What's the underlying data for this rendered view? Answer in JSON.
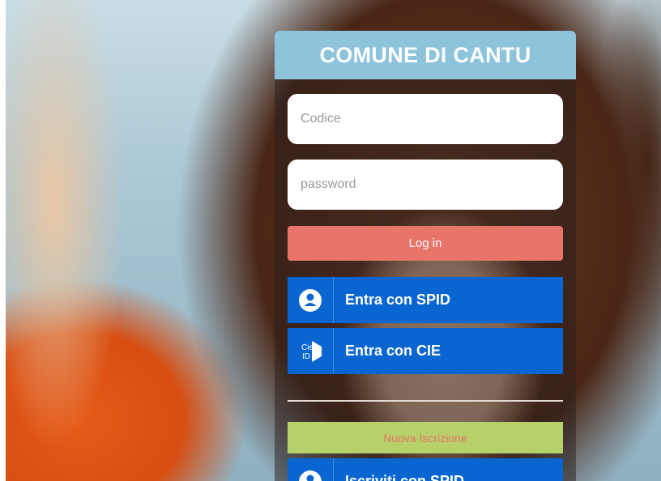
{
  "header": {
    "title": "COMUNE DI CANTU"
  },
  "form": {
    "code_placeholder": "Codice",
    "password_placeholder": "password",
    "login_label": "Log in"
  },
  "spid": {
    "label": "Entra con SPID",
    "icon": "spid-user-icon"
  },
  "cie": {
    "label": "Entra con CIE",
    "icon": "cie-id-icon",
    "icon_text_top": "Cie",
    "icon_text_bottom": "ID"
  },
  "registration": {
    "new_label": "Nuova Iscrizione",
    "spid_label": "Iscriviti con SPID"
  },
  "colors": {
    "header": "#8ec3dc",
    "login": "#e8746a",
    "spid_blue": "#0966d0",
    "new_registration": "#b6d16a"
  }
}
